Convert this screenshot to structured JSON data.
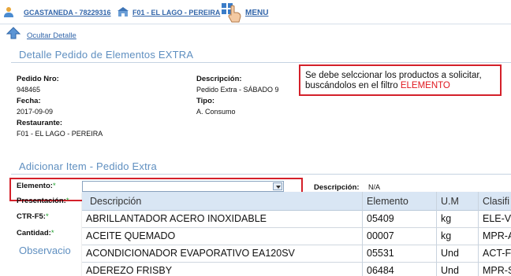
{
  "topbar": {
    "user_link": "GCASTANEDA - 78229316",
    "store_link": "F01 - EL LAGO - PEREIRA",
    "menu_label": "MENU"
  },
  "ocultar_detalle": "Ocultar Detalle",
  "detalle": {
    "title": "Detalle Pedido de Elementos EXTRA",
    "pedido_label": "Pedido Nro:",
    "pedido_value": "948465",
    "fecha_label": "Fecha:",
    "fecha_value": "2017-09-09",
    "restaurante_label": "Restaurante:",
    "restaurante_value": "F01 - EL LAGO - PEREIRA",
    "descripcion_label": "Descripción:",
    "descripcion_value": "Pedido Extra - SÁBADO 9",
    "tipo_label": "Tipo:",
    "tipo_value": "A. Consumo"
  },
  "note": {
    "line1": "Se debe selccionar los productos a solicitar,",
    "line2_prefix": "buscándolos  en el filtro ",
    "line2_highlight": "ELEMENTO"
  },
  "adicionar": {
    "title": "Adicionar Item - Pedido Extra",
    "elemento_label": "Elemento:",
    "presentacion_label": "Presentación:",
    "ctr_label": "CTR-F5:",
    "cantidad_label": "Cantidad:",
    "descripcion_label": "Descripción:",
    "descripcion_value": "N/A",
    "required_mark": "*",
    "elemento_value": ""
  },
  "dropdown": {
    "headers": [
      "Descripción",
      "Elemento",
      "U.M",
      "Clasifi"
    ],
    "rows": [
      [
        "ABRILLANTADOR ACERO INOXIDABLE",
        "05409",
        "kg",
        "ELE-V"
      ],
      [
        "ACEITE QUEMADO",
        "00007",
        "kg",
        "MPR-A"
      ],
      [
        "ACONDICIONADOR EVAPORATIVO   EA120SV",
        "05531",
        "Und",
        "ACT-F"
      ],
      [
        "ADEREZO FRISBY",
        "06484",
        "Und",
        "MPR-S"
      ]
    ]
  },
  "observaciones": "Observacio"
}
